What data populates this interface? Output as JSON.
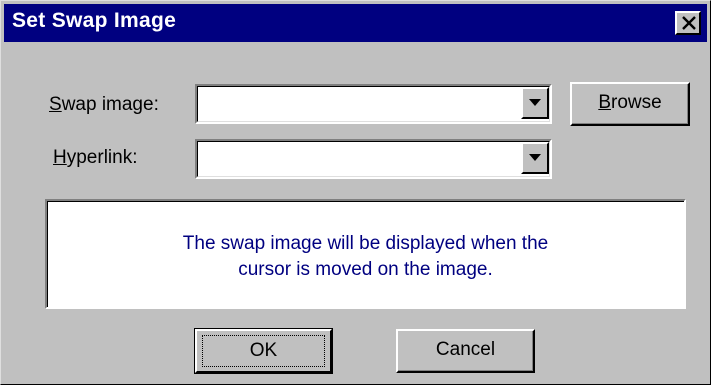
{
  "window": {
    "title": "Set Swap Image",
    "close_icon": "close-icon"
  },
  "form": {
    "swap_image": {
      "label_mnemonic": "S",
      "label_rest": "wap image:",
      "value": "",
      "dropdown_icon": "chevron-down-icon"
    },
    "hyperlink": {
      "label_mnemonic": "H",
      "label_rest": "yperlink:",
      "value": "",
      "dropdown_icon": "chevron-down-icon"
    },
    "browse": {
      "label_mnemonic": "B",
      "label_rest": "rowse"
    }
  },
  "info": {
    "line1": "The swap image will be displayed when the",
    "line2": "cursor is moved on the image.",
    "color": "#000080"
  },
  "buttons": {
    "ok": "OK",
    "cancel": "Cancel"
  },
  "colors": {
    "titlebar": "#000080",
    "dialog_face": "#c0c0c0"
  }
}
